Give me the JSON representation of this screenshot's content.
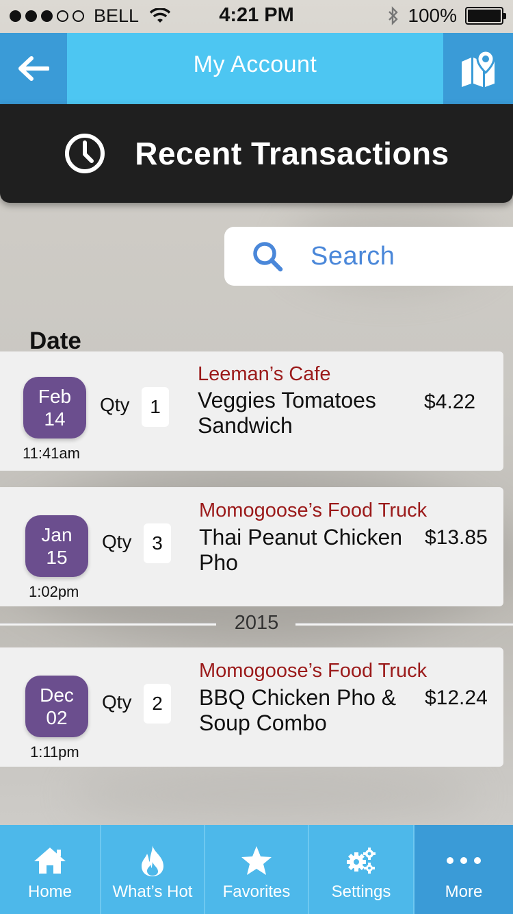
{
  "status_bar": {
    "carrier": "BELL",
    "time": "4:21 PM",
    "battery": "100%"
  },
  "header": {
    "title": "My Account",
    "back_icon": "arrow-left-icon",
    "map_icon": "map-pin-icon"
  },
  "banner": {
    "icon": "clock-icon",
    "title": "Recent Transactions"
  },
  "search": {
    "placeholder": "Search"
  },
  "list": {
    "heading": "Date",
    "year_separator": "2015",
    "transactions": [
      {
        "month": "Feb",
        "day": "14",
        "time": "11:41am",
        "qty_label": "Qty",
        "qty": "1",
        "vendor": "Leeman’s Cafe",
        "item": "Veggies Tomatoes Sandwich",
        "price": "$4.22"
      },
      {
        "month": "Jan",
        "day": "15",
        "time": "1:02pm",
        "qty_label": "Qty",
        "qty": "3",
        "vendor": "Momogoose’s Food Truck",
        "item": "Thai Peanut Chicken Pho",
        "price": "$13.85"
      },
      {
        "month": "Dec",
        "day": "02",
        "time": "1:11pm",
        "qty_label": "Qty",
        "qty": "2",
        "vendor": "Momogoose’s Food Truck",
        "item": "BBQ Chicken Pho & Soup Combo",
        "price": "$12.24"
      }
    ]
  },
  "tabbar": {
    "tabs": [
      {
        "label": "Home",
        "icon": "home-icon"
      },
      {
        "label": "What’s Hot",
        "icon": "flame-icon"
      },
      {
        "label": "Favorites",
        "icon": "star-icon"
      },
      {
        "label": "Settings",
        "icon": "gears-icon"
      },
      {
        "label": "More",
        "icon": "more-dots-icon"
      }
    ],
    "active": "More"
  },
  "colors": {
    "header_blue": "#4dc6f2",
    "header_dark_blue": "#3a9bd7",
    "date_badge_purple": "#6b4e8e",
    "vendor_red": "#9b1a1a",
    "search_blue": "#4a87d9"
  }
}
